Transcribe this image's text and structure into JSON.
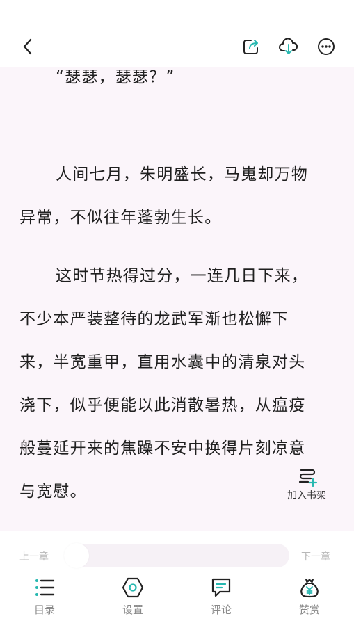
{
  "header": {
    "back_icon": "chevron-left-icon",
    "share_icon": "share-icon",
    "download_icon": "cloud-download-icon",
    "more_icon": "more-dots-icon",
    "accent": "#27b8b0"
  },
  "content": {
    "paragraphs": [
      "“瑟瑟，瑟瑟？”",
      "人间七月，朱明盛长，马嵬却万物异常，不似往年蓬勃生长。",
      "这时节热得过分，一连几日下来，不少本严装整待的龙武军渐也松懈下来，半宽重甲，直用水囊中的清泉对头浇下，似乎便能以此消散暑热，从瘟疫般蔓延开来的焦躁不安中换得片刻凉意与宽慰。"
    ],
    "lines": [
      "“瑟瑟，瑟瑟？”",
      "人间七月，朱明盛长，马嵬却万物",
      "异常，不似往年蓬勃生长。",
      "这时节热得过分，一连几日下来，",
      "不少本严装整待的龙武军渐也松懈下",
      "来，半宽重甲，直用水囊中的清泉对头",
      "浇下，似乎便能以此消散暑热，从瘟疫",
      "般蔓延开来的焦躁不安中换得片刻凉意",
      "与宽慰。"
    ],
    "reader_background": "#fbf5fa"
  },
  "fab": {
    "label": "加入书架",
    "icon": "add-to-shelf-icon"
  },
  "progress": {
    "prev_label": "上一章",
    "next_label": "下一章",
    "value": 0
  },
  "tabs": [
    {
      "label": "目录",
      "icon": "list-icon"
    },
    {
      "label": "设置",
      "icon": "settings-hexagon-icon"
    },
    {
      "label": "评论",
      "icon": "comment-icon"
    },
    {
      "label": "赞赏",
      "icon": "reward-bag-icon"
    }
  ]
}
